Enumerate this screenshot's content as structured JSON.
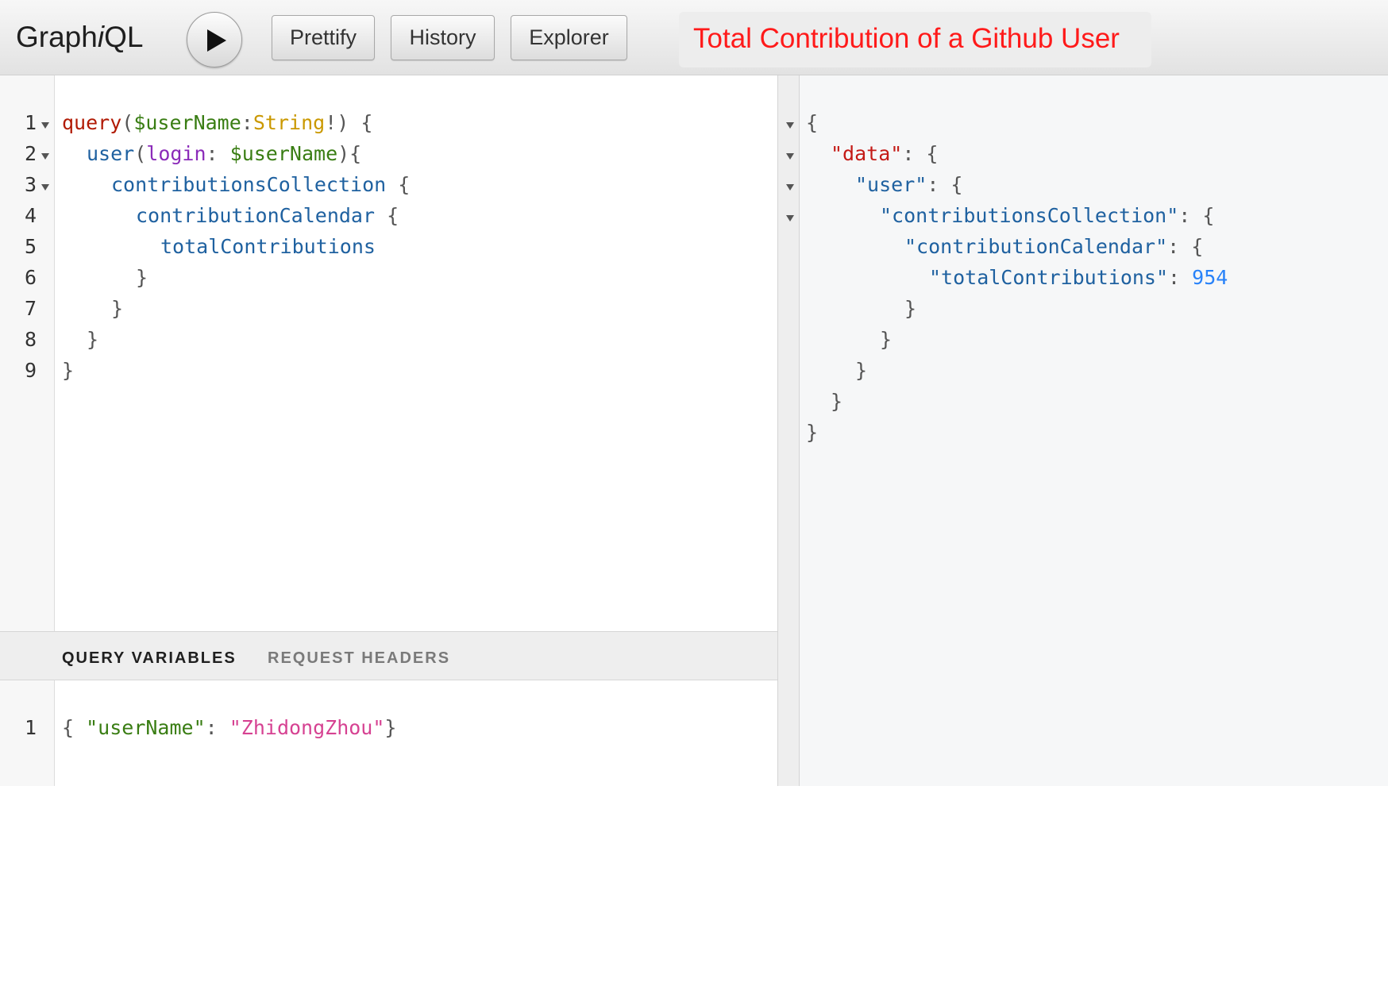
{
  "toolbar": {
    "logo_prefix": "Graph",
    "logo_italic": "i",
    "logo_suffix": "QL",
    "run_icon": "play-icon",
    "prettify_label": "Prettify",
    "history_label": "History",
    "explorer_label": "Explorer",
    "banner_text": "Total Contribution of a Github User",
    "banner_color": "#ff1a1a"
  },
  "query_editor": {
    "line_numbers": [
      "1",
      "2",
      "3",
      "4",
      "5",
      "6",
      "7",
      "8",
      "9"
    ],
    "tokens": {
      "l1": [
        "query",
        "(",
        "$userName",
        ":",
        "String",
        "!",
        ") {"
      ],
      "l2": [
        "user",
        "(",
        "login",
        ": ",
        "$userName",
        "){"
      ],
      "l3": [
        "contributionsCollection",
        " {"
      ],
      "l4": [
        "contributionCalendar",
        " {"
      ],
      "l5": [
        "totalContributions"
      ],
      "l6": [
        "}"
      ],
      "l7": [
        "}"
      ],
      "l8": [
        "}"
      ],
      "l9": [
        "}"
      ]
    }
  },
  "variables_pane": {
    "tab_query_variables": "QUERY VARIABLES",
    "tab_request_headers": "REQUEST HEADERS",
    "line_number": "1",
    "tokens": [
      "{ ",
      "\"userName\"",
      ": ",
      "\"ZhidongZhou\"",
      "}"
    ]
  },
  "result": {
    "tokens": {
      "l1": [
        "{"
      ],
      "l2": [
        "\"data\"",
        ": {"
      ],
      "l3": [
        "\"user\"",
        ": {"
      ],
      "l4": [
        "\"contributionsCollection\"",
        ": {"
      ],
      "l5": [
        "\"contributionCalendar\"",
        ": {"
      ],
      "l6": [
        "\"totalContributions\"",
        ": ",
        "954"
      ],
      "l7": [
        "}"
      ],
      "l8": [
        "}"
      ],
      "l9": [
        "}"
      ],
      "l10": [
        "}"
      ],
      "l11": [
        "}"
      ]
    }
  }
}
